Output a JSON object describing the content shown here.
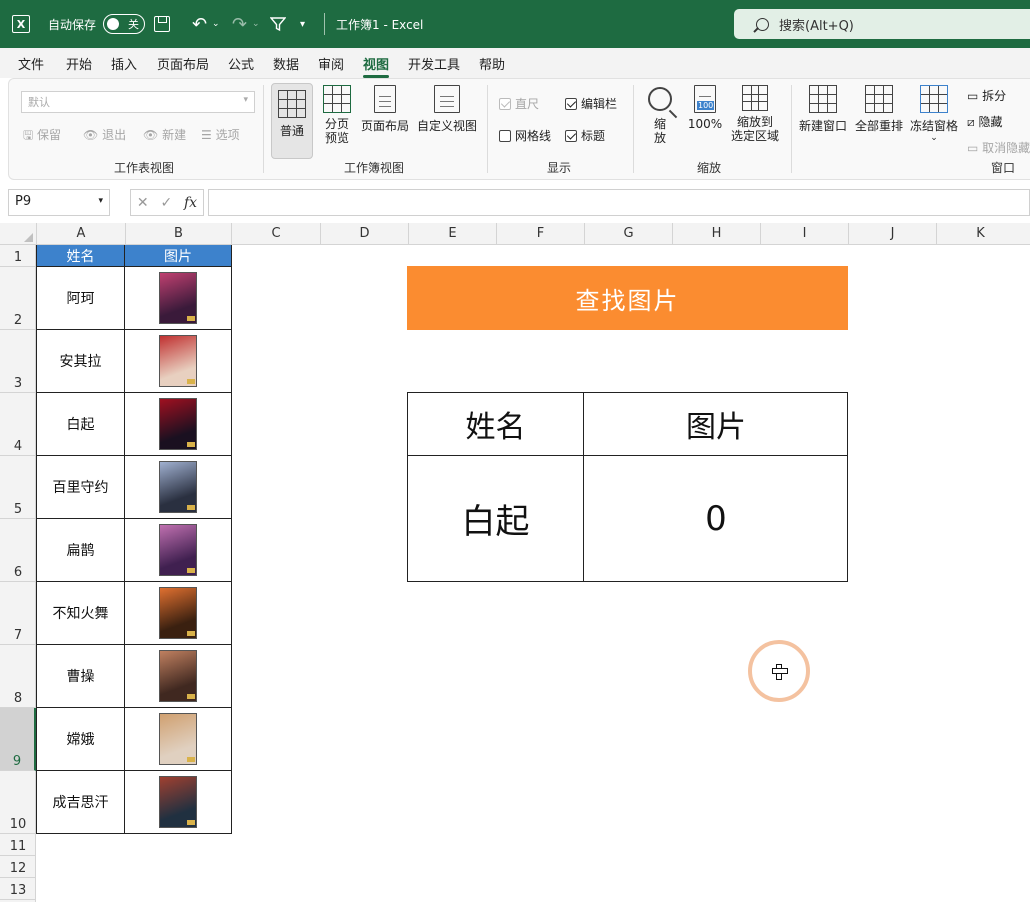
{
  "titlebar": {
    "autosave_label": "自动保存",
    "autosave_state": "关",
    "document_title": "工作簿1  -  Excel",
    "search_placeholder": "搜索(Alt+Q)"
  },
  "menu": [
    "文件",
    "开始",
    "插入",
    "页面布局",
    "公式",
    "数据",
    "审阅",
    "视图",
    "开发工具",
    "帮助"
  ],
  "menu_active_index": 7,
  "ribbon": {
    "sheet_view": {
      "dropdown_value": "默认",
      "keep": "保留",
      "exit": "退出",
      "new": "新建",
      "options": "选项",
      "label": "工作表视图"
    },
    "workbook_view": {
      "normal": "普通",
      "page_break": "分页\n预览",
      "page_layout": "页面布局",
      "custom": "自定义视图",
      "label": "工作簿视图"
    },
    "show": {
      "ruler": "直尺",
      "formula_bar": "编辑栏",
      "gridlines": "网格线",
      "headings": "标题",
      "label": "显示"
    },
    "zoom": {
      "zoom": "缩\n放",
      "hundred": "100%",
      "zoom_selection": "缩放到\n选定区域",
      "label": "缩放"
    },
    "window": {
      "new_window": "新建窗口",
      "arrange_all": "全部重排",
      "freeze": "冻结窗格",
      "split": "拆分",
      "hide": "隐藏",
      "unhide": "取消隐藏",
      "label": "窗口"
    }
  },
  "formula_bar": {
    "name_box": "P9",
    "fx": "fx",
    "value": ""
  },
  "columns": [
    "A",
    "B",
    "C",
    "D",
    "E",
    "F",
    "G",
    "H",
    "I",
    "J",
    "K"
  ],
  "rows": [
    "1",
    "2",
    "3",
    "4",
    "5",
    "6",
    "7",
    "8",
    "9",
    "10",
    "11",
    "12",
    "13"
  ],
  "selected_row": "9",
  "table": {
    "header_name": "姓名",
    "header_image": "图片",
    "names": [
      "阿珂",
      "安其拉",
      "白起",
      "百里守约",
      "扁鹊",
      "不知火舞",
      "曹操",
      "嫦娥",
      "成吉思汗"
    ],
    "thumb_colors": [
      [
        "#3a1a3a",
        "#c04070"
      ],
      [
        "#e8d0c0",
        "#c03030"
      ],
      [
        "#1a1020",
        "#a01020"
      ],
      [
        "#2a3040",
        "#a0b0d0"
      ],
      [
        "#402050",
        "#c070b0"
      ],
      [
        "#3a2010",
        "#e07030"
      ],
      [
        "#402820",
        "#c08060"
      ],
      [
        "#e0d0c0",
        "#d0a070"
      ],
      [
        "#203040",
        "#a04030"
      ]
    ]
  },
  "search_button": "查找图片",
  "lookup": {
    "header_name": "姓名",
    "header_image": "图片",
    "name_value": "白起",
    "image_value": "0"
  }
}
